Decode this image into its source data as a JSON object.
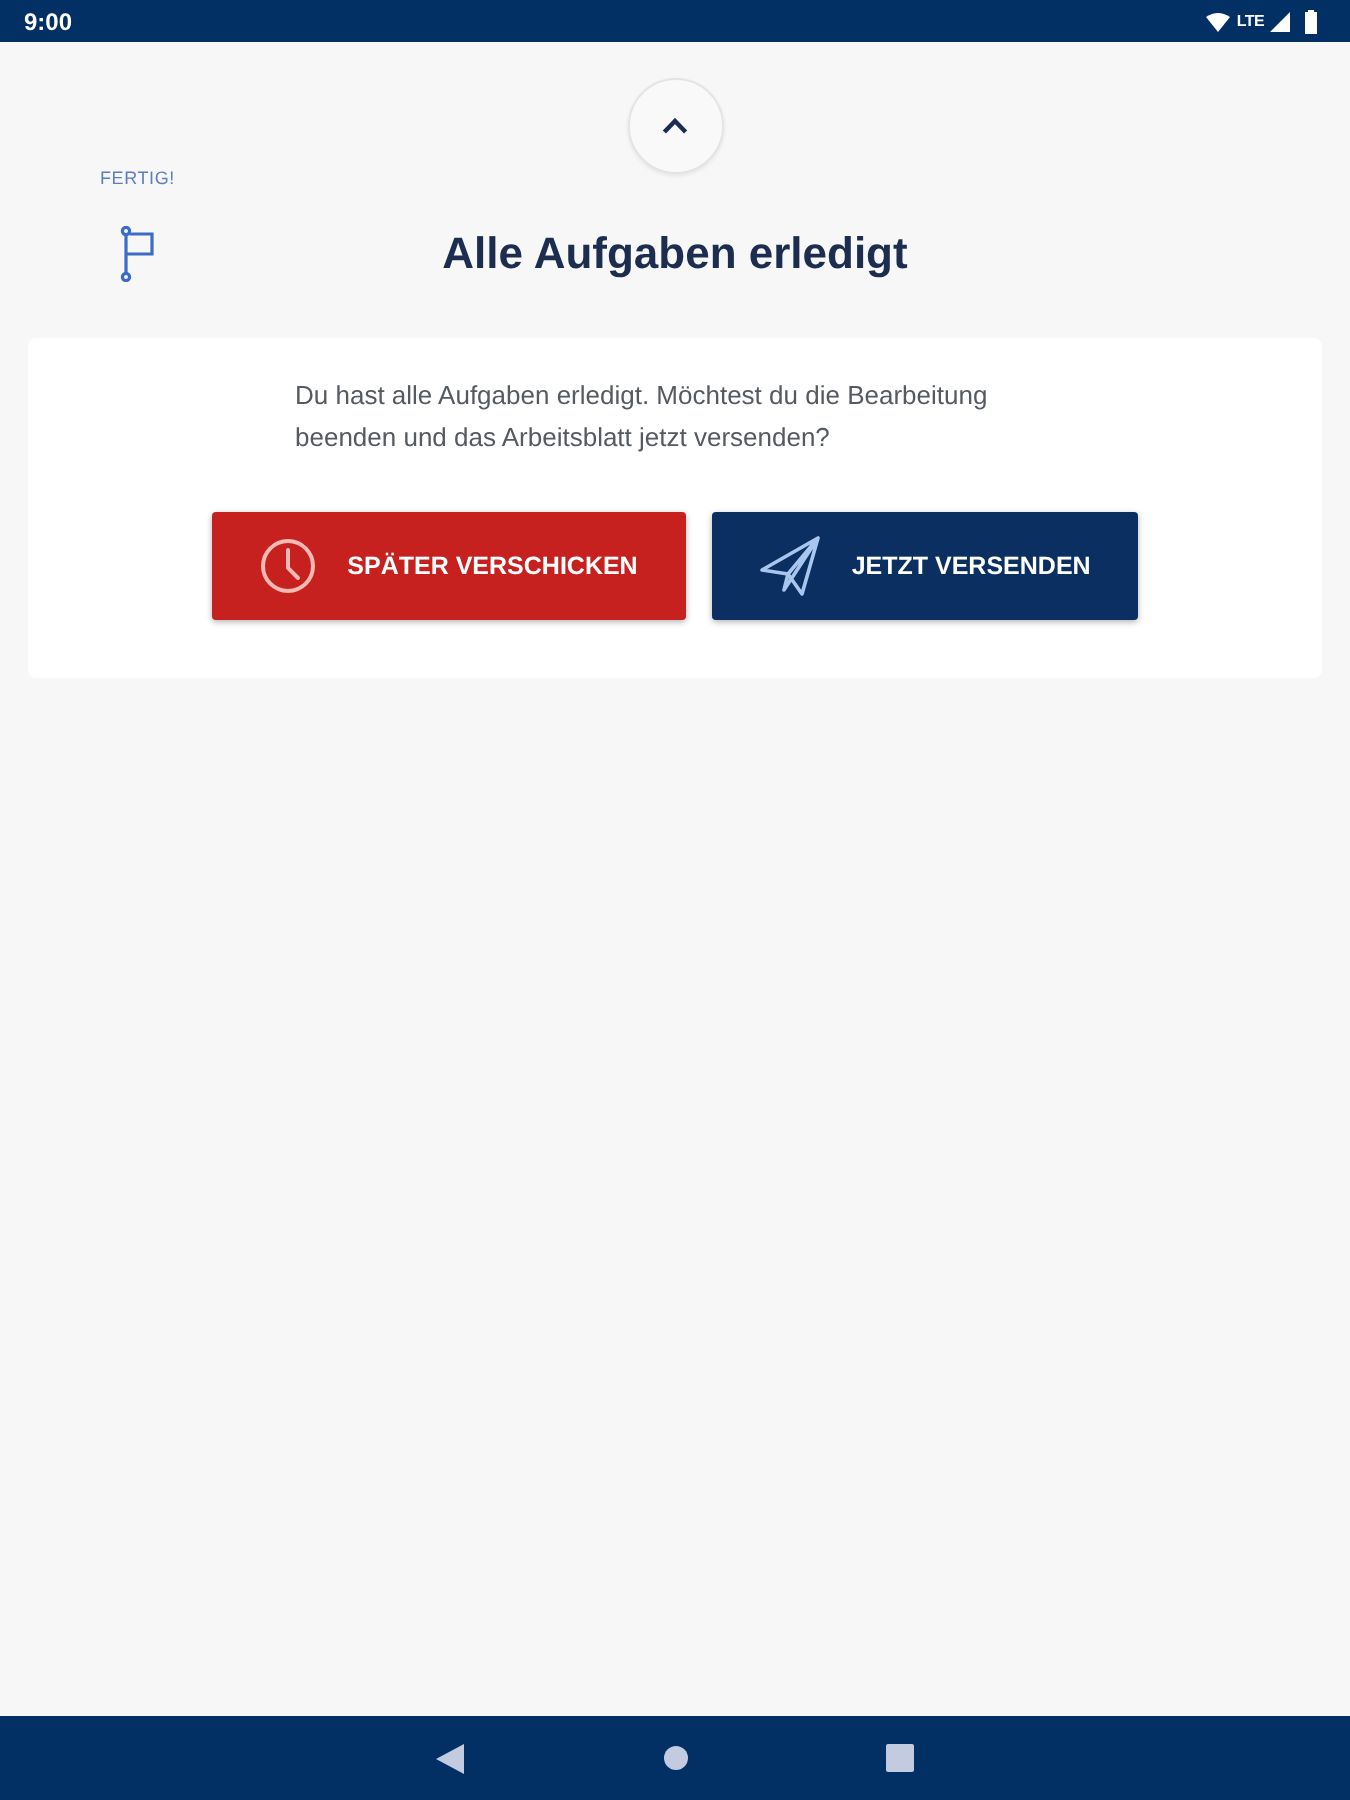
{
  "status_bar": {
    "time": "9:00",
    "network": "LTE"
  },
  "step": {
    "label": "FERTIG!"
  },
  "title": "Alle Aufgaben erledigt",
  "card": {
    "message": "Du hast alle Aufgaben erledigt. Möchtest du die Bearbeitung beenden und das Arbeitsblatt jetzt versenden?",
    "buttons": [
      {
        "label": "SPÄTER VERSCHICKEN",
        "kind": "later"
      },
      {
        "label": "JETZT VERSENDEN",
        "kind": "send"
      }
    ]
  }
}
